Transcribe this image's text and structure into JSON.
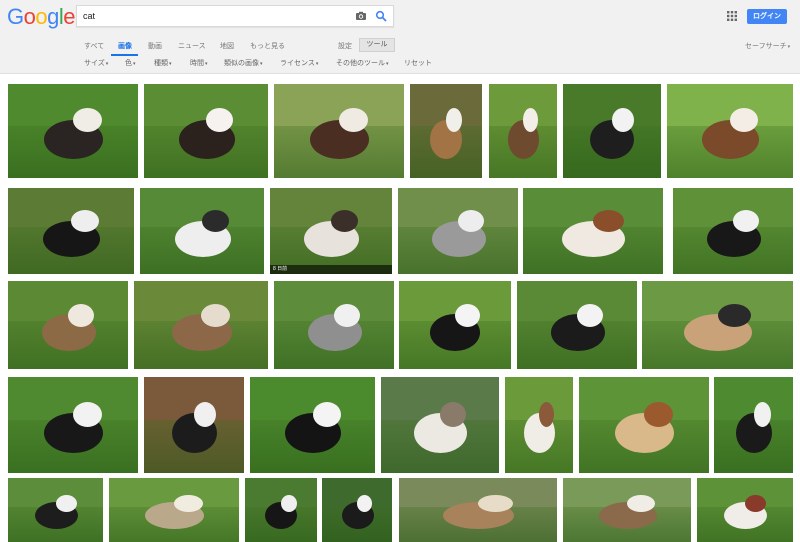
{
  "logo": {
    "letters": [
      {
        "ch": "G",
        "color": "#4285f4"
      },
      {
        "ch": "o",
        "color": "#ea4335"
      },
      {
        "ch": "o",
        "color": "#fbbc05"
      },
      {
        "ch": "g",
        "color": "#4285f4"
      },
      {
        "ch": "l",
        "color": "#34a853"
      },
      {
        "ch": "e",
        "color": "#ea4335"
      }
    ]
  },
  "search": {
    "query": "cat"
  },
  "header": {
    "login_label": "ログイン"
  },
  "tabs": [
    {
      "label": "すべて",
      "active": false
    },
    {
      "label": "画像",
      "active": true
    },
    {
      "label": "動画",
      "active": false
    },
    {
      "label": "ニュース",
      "active": false
    },
    {
      "label": "地図",
      "active": false
    },
    {
      "label": "もっと見る",
      "active": false
    }
  ],
  "settings_label": "設定",
  "tools_label": "ツール",
  "safesearch_label": "セーフサーチ",
  "filters": [
    {
      "label": "サイズ",
      "dropdown": true
    },
    {
      "label": "色",
      "dropdown": true
    },
    {
      "label": "種類",
      "dropdown": true
    },
    {
      "label": "時間",
      "dropdown": true
    },
    {
      "label": "類似の画像",
      "dropdown": true
    },
    {
      "label": "ライセンス",
      "dropdown": true
    },
    {
      "label": "その他のツール",
      "dropdown": true
    },
    {
      "label": "リセット",
      "dropdown": false
    }
  ],
  "colors": {
    "accent": "#1a73e8",
    "login_bg": "#4285f4"
  },
  "thumbnail_caption": "8 日前",
  "results_rows": [
    [
      {
        "bg": "#4f8a2e",
        "dog": "#2a2422",
        "spot": "#f0ece6"
      },
      {
        "bg": "#5b8d34",
        "dog": "#2b211d",
        "spot": "#f5f2ef"
      },
      {
        "bg": "#8aa356",
        "dog": "#4a2e22",
        "spot": "#efeae2"
      },
      {
        "bg": "#6b6a3a",
        "dog": "#a27445",
        "spot": "#f1efe9"
      },
      {
        "bg": "#6d9a3a",
        "dog": "#6e4a2e",
        "spot": "#f3efe8"
      },
      {
        "bg": "#487a2a",
        "dog": "#1f1e1e",
        "spot": "#f2f2f2"
      },
      {
        "bg": "#7fb24a",
        "dog": "#7a4a2a",
        "spot": "#f3ede6"
      }
    ],
    [
      {
        "bg": "#5c7b34",
        "dog": "#161616",
        "spot": "#eeeeee"
      },
      {
        "bg": "#568a36",
        "dog": "#eeeeee",
        "spot": "#2b2b2b"
      },
      {
        "bg": "#63843a",
        "dog": "#e8e2dc",
        "spot": "#3b2f2a",
        "caption": true
      },
      {
        "bg": "#6f8f4a",
        "dog": "#9a9a9a",
        "spot": "#ededed"
      },
      {
        "bg": "#5a8d38",
        "dog": "#efe9e2",
        "spot": "#8a4e2a"
      },
      {
        "bg": "#5f9238",
        "dog": "#181818",
        "spot": "#f1f1f1"
      }
    ],
    [
      {
        "bg": "#5c8a34",
        "dog": "#8c6a46",
        "spot": "#efe8de"
      },
      {
        "bg": "#6a8a3a",
        "dog": "#8d6848",
        "spot": "#e6dccd"
      },
      {
        "bg": "#5d8c3b",
        "dog": "#8f8f8f",
        "spot": "#f0f0f0"
      },
      {
        "bg": "#6a9a3a",
        "dog": "#161616",
        "spot": "#f4f4f4"
      },
      {
        "bg": "#5a8a36",
        "dog": "#1b1b1b",
        "spot": "#f3f3f3"
      },
      {
        "bg": "#6c9a44",
        "dog": "#c9a27a",
        "spot": "#2a2a2a"
      }
    ],
    [
      {
        "bg": "#4f8a30",
        "dog": "#181818",
        "spot": "#f2f2f2"
      },
      {
        "bg": "#7a5a3a",
        "dog": "#1c1c1c",
        "spot": "#f0f0f0"
      },
      {
        "bg": "#4c8a2e",
        "dog": "#141414",
        "spot": "#f4f4f4"
      },
      {
        "bg": "#5a7a4a",
        "dog": "#ece8e2",
        "spot": "#8a7a6a"
      },
      {
        "bg": "#6a9a3a",
        "dog": "#f0ece6",
        "spot": "#8a5a3a"
      },
      {
        "bg": "#5e9438",
        "dog": "#d9b88a",
        "spot": "#9a5a2e"
      },
      {
        "bg": "#4e8a30",
        "dog": "#1a1a1a",
        "spot": "#f1f1f1"
      }
    ],
    [
      {
        "bg": "#5b8d3a",
        "dog": "#1d1d1d",
        "spot": "#f0f0f0"
      },
      {
        "bg": "#6a9a40",
        "dog": "#b9a98a",
        "spot": "#f0ece0"
      },
      {
        "bg": "#4b7b30",
        "dog": "#161616",
        "spot": "#efefef"
      },
      {
        "bg": "#3f6a2e",
        "dog": "#1b1b1b",
        "spot": "#f2f2f2"
      },
      {
        "bg": "#7a8a5a",
        "dog": "#a8825a",
        "spot": "#e6dcc8"
      },
      {
        "bg": "#7a9a5a",
        "dog": "#8a6a4a",
        "spot": "#f0ede6"
      },
      {
        "bg": "#5d9238",
        "dog": "#f0ece8",
        "spot": "#8a3a2a"
      }
    ]
  ]
}
